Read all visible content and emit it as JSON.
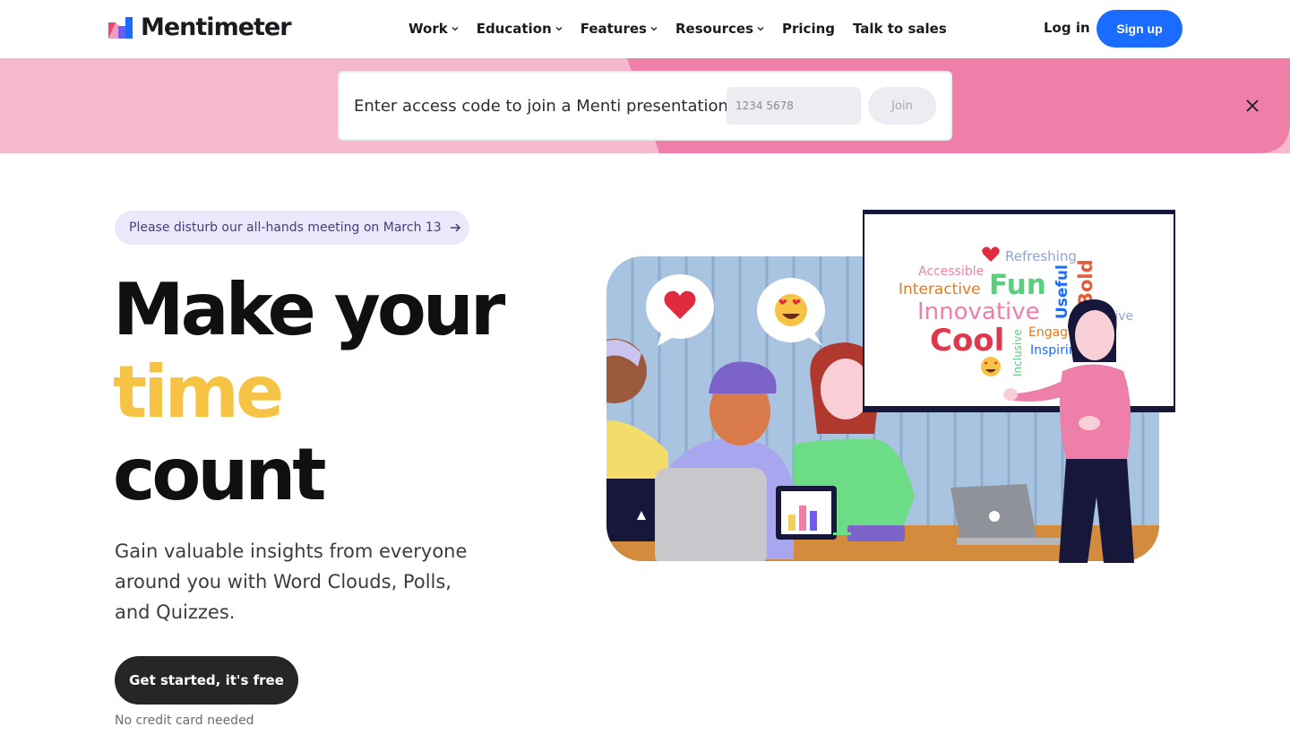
{
  "header": {
    "logo_text": "Mentimeter",
    "nav": [
      {
        "label": "Work",
        "has_dropdown": true
      },
      {
        "label": "Education",
        "has_dropdown": true
      },
      {
        "label": "Features",
        "has_dropdown": true
      },
      {
        "label": "Resources",
        "has_dropdown": true
      },
      {
        "label": "Pricing",
        "has_dropdown": false
      },
      {
        "label": "Talk to sales",
        "has_dropdown": false
      }
    ],
    "login_label": "Log in",
    "signup_label": "Sign up"
  },
  "join_banner": {
    "label": "Enter access code to join a Menti presentation",
    "placeholder": "1234 5678",
    "join_label": "Join",
    "close_icon": "close-icon"
  },
  "hero": {
    "announcement": "Please disturb our all-hands meeting on March 13",
    "headline_line1": "Make your",
    "headline_line2": "time",
    "headline_line3": "count",
    "subtext": "Gain valuable insights from everyone around you with Word Clouds, Polls, and Quizzes.",
    "cta_label": "Get started, it's free",
    "cta_note": "No credit card needed"
  },
  "illustration": {
    "word_cloud": [
      "Refreshing",
      "Accessible",
      "Fun",
      "Useful",
      "Bold",
      "Interactive",
      "Innovative",
      "Reflective",
      "Cool",
      "Engaging",
      "Inclusive",
      "Inspiring"
    ]
  },
  "colors": {
    "brand_blue": "#196cff",
    "accent_yellow": "#f6c344",
    "banner_pink_light": "#f5b8cf",
    "banner_pink_dark": "#ee7fa8",
    "cta_dark": "#262629"
  }
}
